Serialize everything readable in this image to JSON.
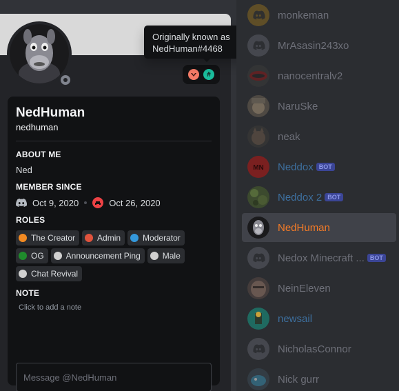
{
  "profile": {
    "display_name": "NedHuman",
    "username": "nedhuman",
    "about_title": "ABOUT ME",
    "about_text": "Ned",
    "member_since_title": "MEMBER SINCE",
    "discord_since": "Oct 9, 2020",
    "server_since": "Oct 26, 2020",
    "roles_title": "ROLES",
    "roles": [
      {
        "name": "The Creator",
        "color": "#f28a22"
      },
      {
        "name": "Admin",
        "color": "#e0533d"
      },
      {
        "name": "Moderator",
        "color": "#3498db"
      },
      {
        "name": "OG",
        "color": "#1f8b2c"
      },
      {
        "name": "Announcement Ping",
        "color": "#d0d0d0"
      },
      {
        "name": "Male",
        "color": "#d0d0d0"
      },
      {
        "name": "Chat Revival",
        "color": "#d0d0d0"
      }
    ],
    "note_title": "NOTE",
    "note_placeholder": "Click to add a note",
    "message_placeholder": "Message @NedHuman"
  },
  "tooltip": {
    "line1": "Originally known as",
    "line2": "NedHuman#4468"
  },
  "members": [
    {
      "name": "monkeman",
      "bot": false,
      "avatar": "discord-yellow",
      "name_style": "dim"
    },
    {
      "name": "MrAsasin243xo",
      "bot": false,
      "avatar": "discord-gray",
      "name_style": "dim"
    },
    {
      "name": "nanocentralv2",
      "bot": false,
      "avatar": "dark-red",
      "name_style": "dim"
    },
    {
      "name": "NaruSke",
      "bot": false,
      "avatar": "tan",
      "name_style": "dim"
    },
    {
      "name": "neak",
      "bot": false,
      "avatar": "cat",
      "name_style": "dim"
    },
    {
      "name": "Neddox",
      "bot": true,
      "avatar": "red-mn",
      "name_style": "accent"
    },
    {
      "name": "Neddox 2",
      "bot": true,
      "avatar": "green-camo",
      "name_style": "accent"
    },
    {
      "name": "NedHuman",
      "bot": false,
      "avatar": "ned",
      "name_style": "orange"
    },
    {
      "name": "Nedox Minecraft ...",
      "bot": true,
      "avatar": "discord-gray",
      "name_style": "dim"
    },
    {
      "name": "NeinEleven",
      "bot": false,
      "avatar": "face",
      "name_style": "dim"
    },
    {
      "name": "newsail",
      "bot": false,
      "avatar": "teal",
      "name_style": "accent"
    },
    {
      "name": "NicholasConnor",
      "bot": false,
      "avatar": "discord-gray",
      "name_style": "dim"
    },
    {
      "name": "Nick gurr",
      "bot": false,
      "avatar": "blue-char",
      "name_style": "dim"
    }
  ],
  "bot_tag": "BOT",
  "colors": {
    "background": "#313338",
    "popout": "#232428",
    "card": "#111214",
    "members": "#2b2d31",
    "accent_name": "#3d6f9e",
    "self_name": "#f47b27"
  }
}
